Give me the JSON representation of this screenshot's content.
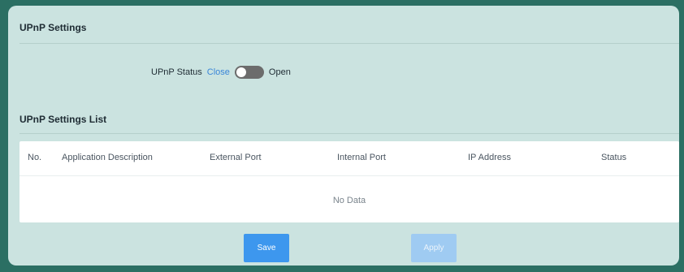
{
  "upnp": {
    "title": "UPnP Settings",
    "status_label": "UPnP Status",
    "close_label": "Close",
    "open_label": "Open"
  },
  "list": {
    "title": "UPnP Settings List",
    "columns": [
      "No.",
      "Application Description",
      "External Port",
      "Internal Port",
      "IP Address",
      "Status"
    ],
    "empty_text": "No Data"
  },
  "actions": {
    "save_label": "Save",
    "apply_label": "Apply"
  },
  "colors": {
    "panel_bg": "#cbe3e0",
    "accent": "#3d97ee",
    "link": "#3a86d8"
  }
}
